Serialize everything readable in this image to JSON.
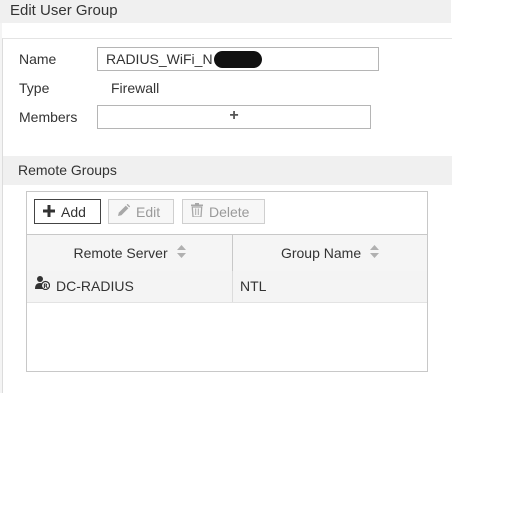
{
  "dialog": {
    "title": "Edit User Group"
  },
  "form": {
    "name_label": "Name",
    "name_value": "RADIUS_WiFi_N",
    "type_label": "Type",
    "type_value": "Firewall",
    "members_label": "Members",
    "members_add": "+"
  },
  "remote_groups": {
    "section_title": "Remote Groups",
    "toolbar": {
      "add_label": "Add",
      "edit_label": "Edit",
      "delete_label": "Delete"
    },
    "columns": [
      "Remote Server",
      "Group Name"
    ],
    "rows": [
      {
        "server": "DC-RADIUS",
        "group": "NTL",
        "icon": "radius-user-icon"
      }
    ]
  },
  "colors": {
    "section_bg": "#f0f0f0",
    "border": "#c8c8c8",
    "disabled_text": "#9a9a9a"
  }
}
